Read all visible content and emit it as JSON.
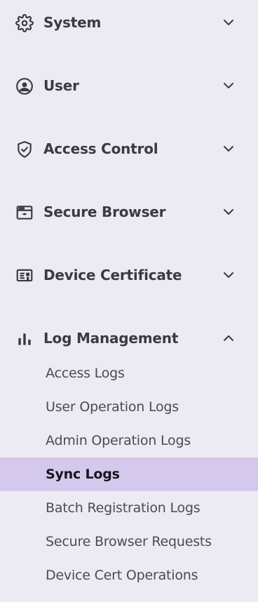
{
  "sidebar": {
    "sections": [
      {
        "label": "System",
        "icon": "gear-icon",
        "expanded": false
      },
      {
        "label": "User",
        "icon": "user-circle-icon",
        "expanded": false
      },
      {
        "label": "Access Control",
        "icon": "shield-check-icon",
        "expanded": false
      },
      {
        "label": "Secure Browser",
        "icon": "browser-window-icon",
        "expanded": false
      },
      {
        "label": "Device Certificate",
        "icon": "certificate-icon",
        "expanded": false
      },
      {
        "label": "Log Management",
        "icon": "bar-chart-icon",
        "expanded": true
      }
    ],
    "log_items": [
      {
        "label": "Access Logs",
        "active": false
      },
      {
        "label": "User Operation Logs",
        "active": false
      },
      {
        "label": "Admin Operation Logs",
        "active": false
      },
      {
        "label": "Sync Logs",
        "active": true
      },
      {
        "label": "Batch Registration Logs",
        "active": false
      },
      {
        "label": "Secure Browser Requests",
        "active": false
      },
      {
        "label": "Device Cert Operations",
        "active": false
      }
    ]
  },
  "colors": {
    "background": "#ecebf4",
    "active_highlight": "#d4c9ec",
    "text_primary": "#3a3a42"
  }
}
